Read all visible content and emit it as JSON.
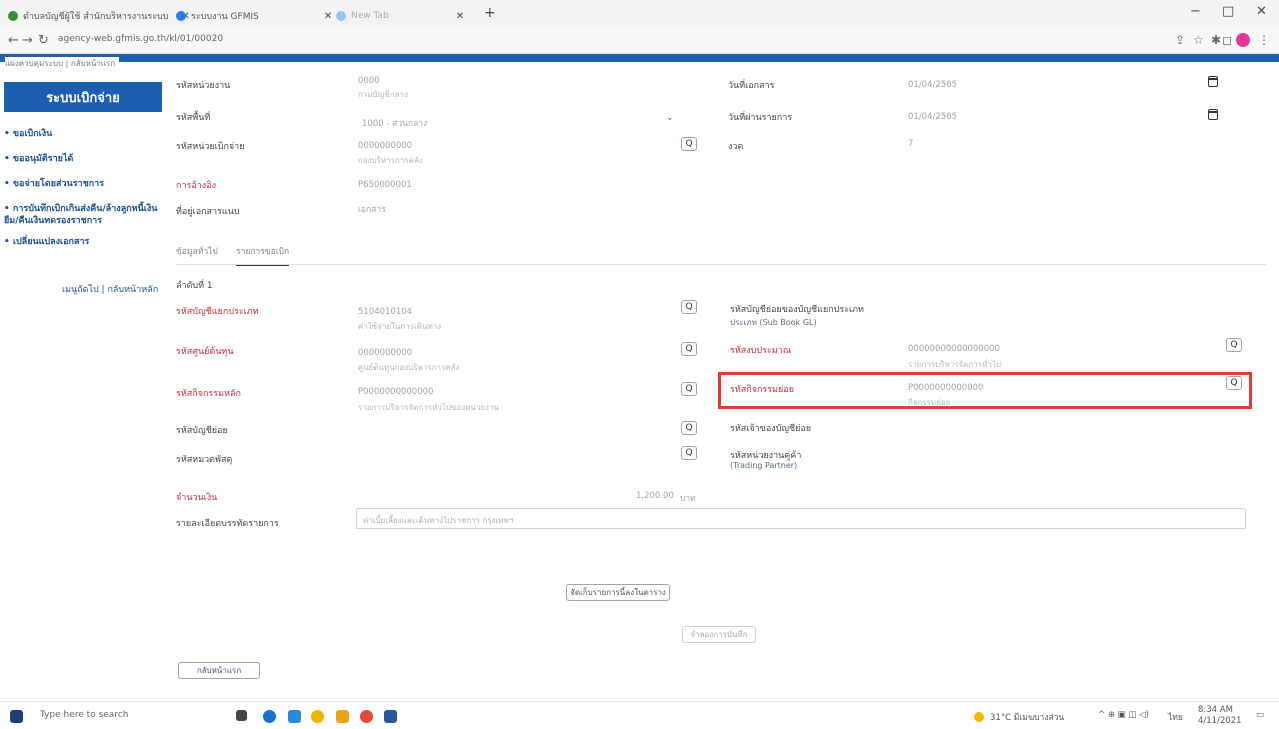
{
  "browser": {
    "tabs": [
      {
        "label": "ตำบลบัญชีผู้ใช้ สำนักบริหารงานระบบ"
      },
      {
        "label": "ระบบงาน GFMIS"
      },
      {
        "label": "New Tab"
      }
    ],
    "new_tab": "+",
    "url": "agency-web.gfmis.go.th/kl/01/00020",
    "window_controls": {
      "minimize": "−",
      "maximize": "□",
      "close": "✕"
    }
  },
  "breadcrumb": "แผงควบคุมระบบ | กลับหน้าแรก",
  "sidebar": {
    "title": "ระบบเบิกจ่าย",
    "items": [
      {
        "label": "• ขอเบิกเงิน"
      },
      {
        "label": "• ขออนุมัติรายได้"
      },
      {
        "label": "• ขอจ่ายโดยส่วนราชการ"
      },
      {
        "label": "• การบันทึกเบิกเกินส่งคืน/ล้างลูกหนี้เงินยืม/คืนเงินทดรองราชการ"
      },
      {
        "label": "• เปลี่ยนแปลงเอกสาร"
      }
    ],
    "note": "เมนูถัดไป | กลับหน้าหลัก"
  },
  "header_fields": {
    "agency_code": {
      "label": "รหัสหน่วยงาน",
      "value": "0000",
      "sub": "กรมบัญชีกลาง"
    },
    "area_code": {
      "label": "รหัสพื้นที่",
      "value": "1000 - ส่วนกลาง"
    },
    "disbursement_unit": {
      "label": "รหัสหน่วยเบิกจ่าย",
      "value": "0000000000",
      "sub": "กองบริหารการคลัง"
    },
    "reference": {
      "label": "การอ้างอิง",
      "value": "P650000001"
    },
    "attachment": {
      "label": "ที่อยู่เอกสารแนบ",
      "value": "เอกสาร"
    },
    "doc_date": {
      "label": "วันที่เอกสาร",
      "value": "01/04/2565"
    },
    "post_date": {
      "label": "วันที่ผ่านรายการ",
      "value": "01/04/2565"
    },
    "period": {
      "label": "งวด",
      "value": "7"
    }
  },
  "tabs": {
    "general": "ข้อมูลทั่วไป",
    "details": "รายการขอเบิก"
  },
  "detail": {
    "sequence": "ลำดับที่ 1",
    "left": [
      {
        "label": "รหัสบัญชีแยกประเภท",
        "value": "5104010104",
        "sub": "ค่าใช้จ่ายในการเดินทาง",
        "red": true
      },
      {
        "label": "รหัสศูนย์ต้นทุน",
        "value": "0000000000",
        "sub": "ศูนย์ต้นทุนกองบริหารการคลัง",
        "red": true
      },
      {
        "label": "รหัสกิจกรรมหลัก",
        "value": "P0000000000000",
        "sub": "รายการบริหารจัดการทั่วไปของหน่วยงาน",
        "red": true
      },
      {
        "label": "รหัสบัญชีย่อย",
        "value": "",
        "sub": "",
        "red": false
      },
      {
        "label": "รหัสหมวดพัสดุ",
        "value": "",
        "sub": "",
        "red": false
      }
    ],
    "right": [
      {
        "label": "รหัสบัญชีย่อยของบัญชีแยกประเภท",
        "sub_label": "ประเภท (Sub Book GL)",
        "value": "",
        "sub": "",
        "red": false
      },
      {
        "label": "รหัสงบประมาณ",
        "value": "00000000000000000",
        "sub": "รายการบริหารจัดการทั่วไป",
        "red": true
      },
      {
        "label": "รหัสกิจกรรมย่อย",
        "value": "P0000000000000",
        "sub": "กิจกรรมย่อย",
        "red": true
      },
      {
        "label": "รหัสเจ้าของบัญชีย่อย",
        "value": "",
        "sub": "",
        "red": false
      },
      {
        "label": "รหัสหน่วยงานคู่ค้า",
        "sub_label": "(Trading Partner)",
        "value": "",
        "sub": "",
        "red": false
      }
    ],
    "amount_label": "จำนวนเงิน",
    "amount_value": "1,200.00",
    "amount_unit": "บาท",
    "description_label": "รายละเอียดบรรทัดรายการ",
    "description_value": "ค่าเบี้ยเลี้ยงและเดินทางไปราชการ กรุงเทพฯ"
  },
  "buttons": {
    "save_item": "จัดเก็บรายการนี้ลงในตาราง",
    "simulate": "จำลองการบันทึก",
    "back": "กลับหน้าแรก",
    "search": "Q"
  },
  "taskbar": {
    "search_placeholder": "Type here to search",
    "weather": "31°C มีเมฆบางส่วน",
    "lang": "ไทย",
    "time": "8:34 AM",
    "date": "4/11/2021"
  }
}
